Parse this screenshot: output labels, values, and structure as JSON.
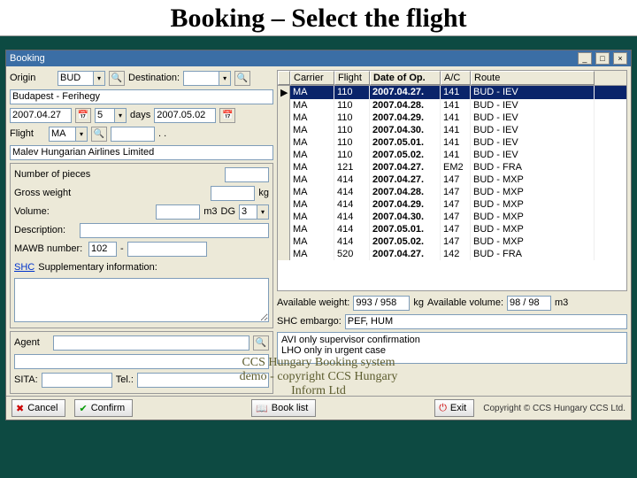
{
  "slide_title": "Booking – Select the flight",
  "window_title": "Booking",
  "labels": {
    "origin": "Origin",
    "destination": "Destination:",
    "days": "days",
    "flight": "Flight",
    "num_pieces": "Number of pieces",
    "gross_weight": "Gross weight",
    "volume": "Volume:",
    "kg": "kg",
    "m3": "m3",
    "dg": "DG",
    "description": "Description:",
    "mawb": "MAWB number:",
    "shc_link": "SHC",
    "supp": "Supplementary information:",
    "agent": "Agent",
    "sita": "SITA:",
    "tel": "Tel.:",
    "avail_weight": "Available weight:",
    "avail_weight_unit": "kg",
    "avail_volume": "Available volume:",
    "avail_volume_unit": "m3",
    "shc_embargo": "SHC embargo:"
  },
  "values": {
    "origin": "BUD",
    "origin_full": "Budapest - Ferihegy",
    "date1": "2007.04.27",
    "days": "5",
    "date2": "2007.05.02",
    "carrier": "MA",
    "flight_full": "Malev Hungarian Airlines Limited",
    "mawb_prefix": "102",
    "dg": "3",
    "avail_weight": "993 / 958",
    "avail_volume": "98 / 98",
    "shc_embargo": "PEF, HUM",
    "restriction_note": "AVI only supervisor confirmation\nLHO only in urgent case"
  },
  "table": {
    "headers": {
      "carrier": "Carrier",
      "flight": "Flight",
      "date": "Date of Op.",
      "ac": "A/C",
      "route": "Route"
    },
    "rows": [
      {
        "carrier": "MA",
        "flight": "110",
        "date": "2007.04.27.",
        "ac": "141",
        "route": "BUD - IEV",
        "sel": true
      },
      {
        "carrier": "MA",
        "flight": "110",
        "date": "2007.04.28.",
        "ac": "141",
        "route": "BUD - IEV"
      },
      {
        "carrier": "MA",
        "flight": "110",
        "date": "2007.04.29.",
        "ac": "141",
        "route": "BUD - IEV"
      },
      {
        "carrier": "MA",
        "flight": "110",
        "date": "2007.04.30.",
        "ac": "141",
        "route": "BUD - IEV"
      },
      {
        "carrier": "MA",
        "flight": "110",
        "date": "2007.05.01.",
        "ac": "141",
        "route": "BUD - IEV"
      },
      {
        "carrier": "MA",
        "flight": "110",
        "date": "2007.05.02.",
        "ac": "141",
        "route": "BUD - IEV"
      },
      {
        "carrier": "MA",
        "flight": "121",
        "date": "2007.04.27.",
        "ac": "EM2",
        "route": "BUD - FRA"
      },
      {
        "carrier": "MA",
        "flight": "414",
        "date": "2007.04.27.",
        "ac": "147",
        "route": "BUD - MXP"
      },
      {
        "carrier": "MA",
        "flight": "414",
        "date": "2007.04.28.",
        "ac": "147",
        "route": "BUD - MXP"
      },
      {
        "carrier": "MA",
        "flight": "414",
        "date": "2007.04.29.",
        "ac": "147",
        "route": "BUD - MXP"
      },
      {
        "carrier": "MA",
        "flight": "414",
        "date": "2007.04.30.",
        "ac": "147",
        "route": "BUD - MXP"
      },
      {
        "carrier": "MA",
        "flight": "414",
        "date": "2007.05.01.",
        "ac": "147",
        "route": "BUD - MXP"
      },
      {
        "carrier": "MA",
        "flight": "414",
        "date": "2007.05.02.",
        "ac": "147",
        "route": "BUD - MXP"
      },
      {
        "carrier": "MA",
        "flight": "520",
        "date": "2007.04.27.",
        "ac": "142",
        "route": "BUD - FRA"
      }
    ]
  },
  "buttons": {
    "cancel": "Cancel",
    "confirm": "Confirm",
    "book_list": "Book list",
    "exit": "Exit"
  },
  "overlay": "CCS Hungary Booking system\ndemo - copyright CCS Hungary\nInform Ltd",
  "copyright": "Copyright © CCS Hungary CCS Ltd."
}
